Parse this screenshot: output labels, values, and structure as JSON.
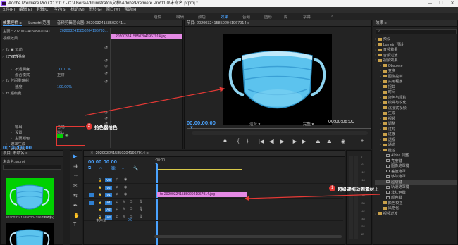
{
  "window": {
    "title": "Adobe Premiere Pro CC 2017 - C:\\Users\\Administrator\\文档\\Adobe\\Premiere Pro\\11.0\\未命名.prproj *",
    "min": "—",
    "max": "☐",
    "close": "✕"
  },
  "menu": [
    "文件(F)",
    "编辑(E)",
    "剪辑(C)",
    "序列(S)",
    "标记(M)",
    "图形(G)",
    "窗口(W)",
    "帮助(H)"
  ],
  "workspaces": [
    "组件",
    "编辑",
    "颜色",
    "效果",
    "音频",
    "图形",
    "库",
    "字幕"
  ],
  "workspace_active": "效果",
  "effect_controls": {
    "tabs": [
      "效果控件 ≡",
      "Lumetri 范围",
      "音频剪辑混合器: 20200324158502041..."
    ],
    "master": "主要 * 202003241585020041...",
    "clip_link": "2020032415850204196793...",
    "clip_bar": "20200324158502041967914.jpg",
    "section_video": "视频效果",
    "rows": [
      {
        "label": "fx ▣ 运动"
      },
      {
        "label": "fx 不透明度"
      },
      {
        "label": "不透明度",
        "value": "100.0 %"
      },
      {
        "label": "混合模式",
        "value": "正常"
      },
      {
        "label": "fx 时间重映射"
      },
      {
        "label": "速度",
        "value": "100.00%"
      },
      {
        "label": "fx 超级键"
      },
      {
        "label": "输出",
        "value": "合成"
      },
      {
        "label": "设置",
        "value": "默认"
      },
      {
        "label": "主要颜色",
        "value": ""
      },
      {
        "label": "遮罩生成"
      },
      {
        "label": "遮罩清除"
      },
      {
        "label": "溢出抑制"
      }
    ],
    "timecode": "00:00:00:00"
  },
  "program": {
    "title": "节目: 20200324158502041967914 ≡",
    "timecode_left": "00:00:00:00",
    "fit": "适合",
    "quality": "完整",
    "timecode_right": "00:00:05:00"
  },
  "effects_panel": {
    "title": "效果 ≡",
    "items": [
      {
        "label": "预设",
        "depth": 0,
        "folder": true
      },
      {
        "label": "Lumetri 预设",
        "depth": 0,
        "folder": true
      },
      {
        "label": "音频效果",
        "depth": 0,
        "folder": true
      },
      {
        "label": "音频过渡",
        "depth": 0,
        "folder": true
      },
      {
        "label": "视频效果",
        "depth": 0,
        "folder": true
      },
      {
        "label": "Obsolete",
        "depth": 1,
        "folder": true
      },
      {
        "label": "变换",
        "depth": 1,
        "folder": true
      },
      {
        "label": "图像控制",
        "depth": 1,
        "folder": true
      },
      {
        "label": "实用程序",
        "depth": 1,
        "folder": true
      },
      {
        "label": "扭曲",
        "depth": 1,
        "folder": true
      },
      {
        "label": "时间",
        "depth": 1,
        "folder": true
      },
      {
        "label": "杂色与颗粒",
        "depth": 1,
        "folder": true
      },
      {
        "label": "模糊与锐化",
        "depth": 1,
        "folder": true
      },
      {
        "label": "沉浸式视频",
        "depth": 1,
        "folder": true
      },
      {
        "label": "生成",
        "depth": 1,
        "folder": true
      },
      {
        "label": "视频",
        "depth": 1,
        "folder": true
      },
      {
        "label": "调整",
        "depth": 1,
        "folder": true
      },
      {
        "label": "过时",
        "depth": 1,
        "folder": true
      },
      {
        "label": "过渡",
        "depth": 1,
        "folder": true
      },
      {
        "label": "透视",
        "depth": 1,
        "folder": true
      },
      {
        "label": "通道",
        "depth": 1,
        "folder": true
      },
      {
        "label": "键控",
        "depth": 1,
        "folder": true
      },
      {
        "label": "Alpha 调整",
        "depth": 2,
        "folder": false
      },
      {
        "label": "亮度键",
        "depth": 2,
        "folder": false
      },
      {
        "label": "图像遮罩键",
        "depth": 2,
        "folder": false
      },
      {
        "label": "差值遮罩",
        "depth": 2,
        "folder": false
      },
      {
        "label": "移除遮罩",
        "depth": 2,
        "folder": false
      },
      {
        "label": "超级键",
        "depth": 2,
        "folder": false,
        "selected": true
      },
      {
        "label": "轨道遮罩键",
        "depth": 2,
        "folder": false
      },
      {
        "label": "非红色键",
        "depth": 2,
        "folder": false
      },
      {
        "label": "颜色键",
        "depth": 2,
        "folder": false
      },
      {
        "label": "颜色校正",
        "depth": 1,
        "folder": true
      },
      {
        "label": "风格化",
        "depth": 1,
        "folder": true
      },
      {
        "label": "视频过渡",
        "depth": 0,
        "folder": true
      }
    ]
  },
  "project": {
    "title": "项目: 未命名 ≡",
    "file": "未命名.prproj",
    "clip_name": "20200324158502041967914.jpg",
    "duration": "5:00"
  },
  "timeline": {
    "title": "20200324158502041967914 ≡",
    "timecode": "00:00:00:00",
    "ruler_start": ":00:00",
    "ruler_mid": "00:00:05:00",
    "clip_label": "20200324158502041967914.jpg",
    "tracks": [
      {
        "name": "V3",
        "type": "video"
      },
      {
        "name": "V2",
        "type": "video"
      },
      {
        "name": "V1",
        "type": "video",
        "source": "V1"
      },
      {
        "name": "A1",
        "type": "audio",
        "source": "A1"
      },
      {
        "name": "A2",
        "type": "audio"
      },
      {
        "name": "A3",
        "type": "audio"
      }
    ],
    "master_label": "主声道",
    "master_value": "0.0"
  },
  "meter_ticks": [
    "0",
    "-6",
    "-12",
    "-18",
    "-24",
    "-30",
    "-36",
    "-42",
    "-48",
    "-54",
    "dB"
  ],
  "annotations": {
    "a1_num": "1",
    "a1_text": "超级键拖动到素材上",
    "a2_num": "2",
    "a2_text": "拾色器拾色"
  },
  "colors": {
    "accent": "#4aa3ff",
    "annotation": "#e53935",
    "green_screen": "#00d000",
    "clip_pink": "#e58ae5"
  }
}
